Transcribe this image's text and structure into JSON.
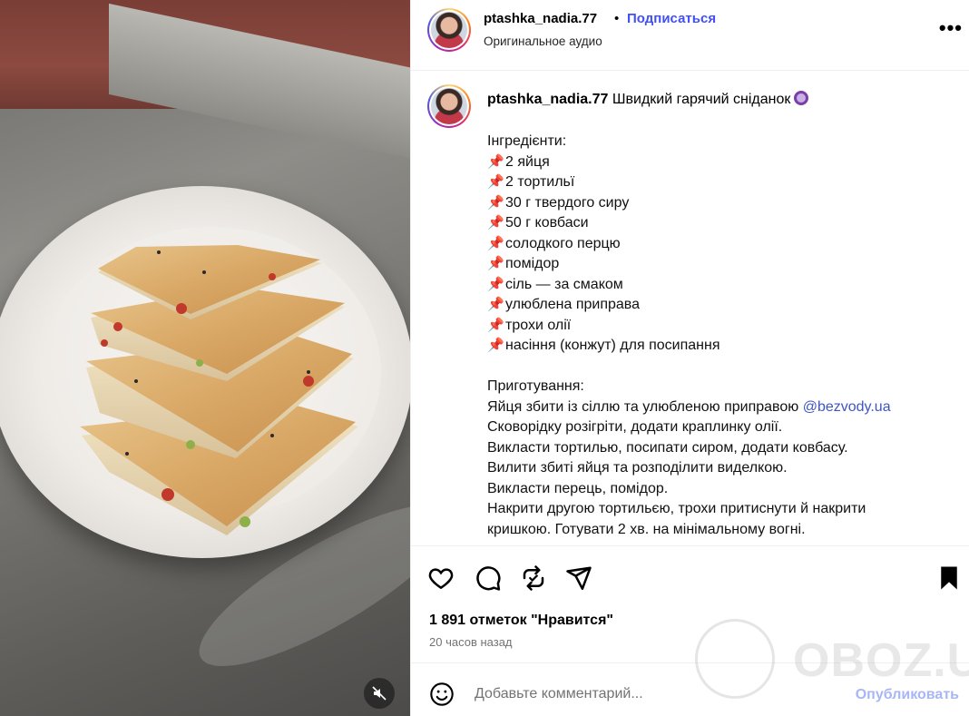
{
  "post": {
    "username": "ptashka_nadia.77",
    "separator": "•",
    "follow_label": "Подписаться",
    "audio_label": "Оригинальное аудио",
    "more_label": "•••"
  },
  "caption": {
    "username": "ptashka_nadia.77",
    "title": "Швидкий гарячий сніданок",
    "ingredients_heading": "Інгредієнти:",
    "ingredients": [
      "2 яйця",
      "2 тортильї",
      "30 г твердого сиру",
      "50 г ковбаси",
      "солодкого перцю",
      "помідор",
      "сіль — за смаком",
      "улюблена приправа",
      "трохи олії",
      "насіння (конжут) для посипання"
    ],
    "pin_icon": "📌",
    "method_heading": "Приготування:",
    "step1_text": "Яйця збити із сіллю та улюбленою приправою ",
    "step1_link": "@bezvody.ua",
    "steps": [
      "Сковорідку розігріти, додати краплинку олії.",
      "Викласти тортилью, посипати сиром, додати ковбасу.",
      "Вилити збиті яйця та розподілити виделкою.",
      "Викласти перець, помідор.",
      "Накрити другою тортильєю, трохи притиснути й накрити",
      "кришкою. Готувати 2 хв. на мінімальному вогні."
    ]
  },
  "actions": {
    "icons": [
      "heart-icon",
      "comment-icon",
      "repost-icon",
      "share-icon",
      "bookmark-icon"
    ]
  },
  "stats": {
    "likes": "1 891 отметок \"Нравится\"",
    "time_ago": "20 часов назад"
  },
  "comment": {
    "placeholder": "Добавьте комментарий...",
    "publish_label": "Опубликовать"
  },
  "watermark": {
    "text": "OBOZ.UA"
  },
  "colors": {
    "accent": "#4150f7",
    "publish_disabled": "#a7b6f5",
    "link": "#3e55c4",
    "pin": "#e0245e"
  }
}
